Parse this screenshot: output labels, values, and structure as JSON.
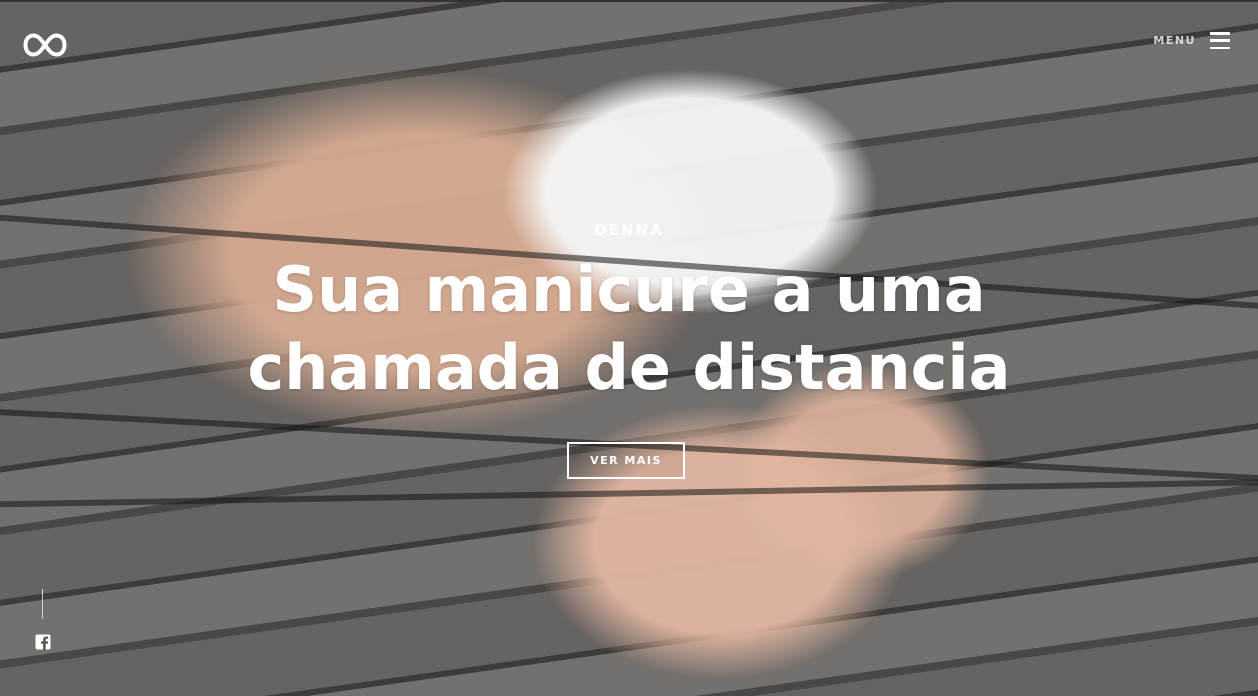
{
  "brand": {
    "logo_icon": "infinity-icon"
  },
  "header": {
    "menu_label": "MENU",
    "menu_icon": "hamburger-menu-icon"
  },
  "hero": {
    "eyebrow": "DENNA",
    "headline_line1": "Sua manicure a uma",
    "headline_line2": "chamada de distancia",
    "cta_label": "VER MAIS"
  },
  "social": {
    "facebook_icon": "facebook-icon"
  },
  "colors": {
    "text": "#ffffff",
    "top_border": "#2f3236",
    "wood_dark": "#3d3c3a",
    "wood_light": "#74706d",
    "skin": "#d6aa91",
    "flower": "#f5f6f6"
  }
}
